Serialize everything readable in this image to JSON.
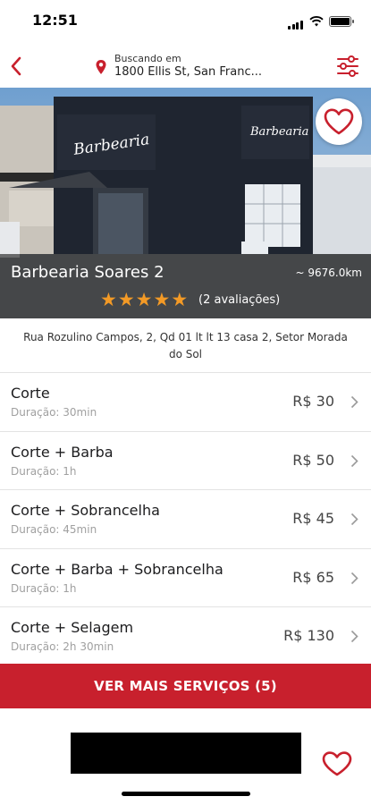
{
  "status": {
    "time": "12:51"
  },
  "header": {
    "location_label": "Buscando em",
    "location_value": "1800 Ellis St, San Franc..."
  },
  "shop": {
    "sign_text": "Barbearia",
    "name": "Barbearia Soares 2",
    "distance": "~ 9676.0km",
    "rating": 5,
    "reviews": "(2 avaliações)",
    "address": "Rua Rozulino Campos, 2, Qd 01 lt lt 13 casa 2, Setor Morada do Sol"
  },
  "services": [
    {
      "name": "Corte",
      "duration": "Duração: 30min",
      "price": "R$ 30"
    },
    {
      "name": "Corte + Barba",
      "duration": "Duração: 1h",
      "price": "R$ 50"
    },
    {
      "name": "Corte + Sobrancelha",
      "duration": "Duração: 45min",
      "price": "R$ 45"
    },
    {
      "name": "Corte + Barba + Sobrancelha",
      "duration": "Duração: 1h",
      "price": "R$ 65"
    },
    {
      "name": "Corte + Selagem",
      "duration": "Duração: 2h 30min",
      "price": "R$ 130"
    }
  ],
  "more_button": "VER MAIS SERVIÇOS (5)",
  "colors": {
    "accent": "#c8202d",
    "star": "#f39a26"
  },
  "icons": [
    "back-icon",
    "location-pin-icon",
    "filter-icon",
    "heart-icon",
    "star-icon",
    "chevron-right-icon"
  ]
}
